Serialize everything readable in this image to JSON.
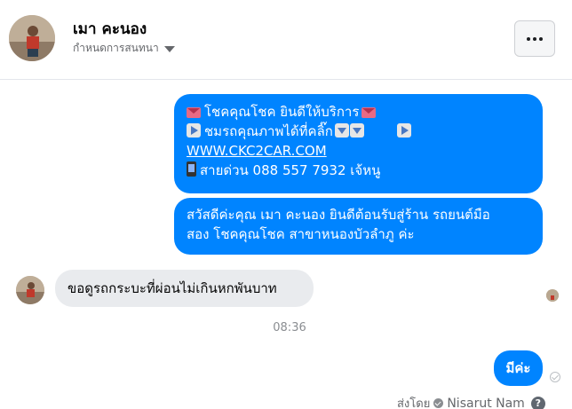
{
  "header": {
    "name": "เมา คะนอง",
    "subtitle": "กำหนดการสนทนา",
    "more_label": "More options"
  },
  "messages": {
    "out1": {
      "line1": "โชคคุณโชค ยินดีให้บริการ",
      "line2": "ชมรถคุณภาพได้ที่คลิ๊ก",
      "link": "WWW.CKC2CAR.COM",
      "line4": "สายด่วน 088 557 7932 เจ้หนู"
    },
    "out2": {
      "line1": "สวัสดีค่ะคุณ เมา คะนอง ยินดีต้อนรับสู่ร้าน รถยนต์มือ",
      "line2": "สอง โชคคุณโชค สาขาหนองบัวลำภู ค่ะ"
    },
    "in1": "ขอดูรถกระบะที่ผ่อนไม่เกินหกพันบาท",
    "timestamp": "08:36",
    "out3": "มีค่ะ"
  },
  "footer": {
    "sent_by_label": "ส่งโดย",
    "sender_name": "Nisarut Nam",
    "help_label": "?"
  },
  "colors": {
    "outgoing_bubble": "#0084ff",
    "incoming_bubble": "#e9ebee",
    "secondary_text": "#65676b"
  },
  "icons": [
    "envelope-heart-icon",
    "play-button-icon",
    "down-arrow-icon",
    "mobile-phone-icon",
    "caret-down-icon",
    "more-dots-icon",
    "verified-shield-icon",
    "help-icon",
    "sent-check-icon"
  ]
}
